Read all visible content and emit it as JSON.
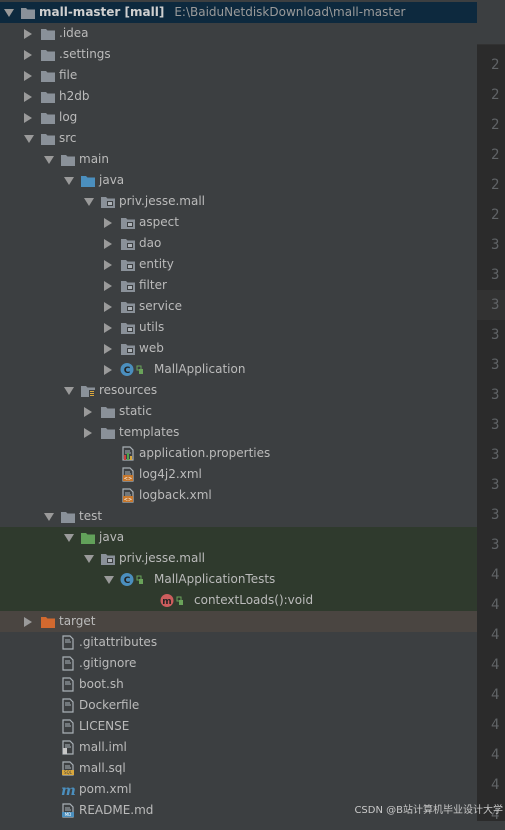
{
  "project": {
    "name": "mall-master",
    "module": "[mall]",
    "path": "E:\\BaiduNetdiskDownload\\mall-master"
  },
  "tree": {
    "idea": ".idea",
    "settings": ".settings",
    "file": "file",
    "h2db": "h2db",
    "log": "log",
    "src": "src",
    "main": "main",
    "main_java": "java",
    "main_pkg": "priv.jesse.mall",
    "aspect": "aspect",
    "dao": "dao",
    "entity": "entity",
    "filter": "filter",
    "service": "service",
    "utils": "utils",
    "web": "web",
    "mall_application": "MallApplication",
    "resources": "resources",
    "static": "static",
    "templates": "templates",
    "application_properties": "application.properties",
    "log4j2": "log4j2.xml",
    "logback": "logback.xml",
    "test": "test",
    "test_java": "java",
    "test_pkg": "priv.jesse.mall",
    "mall_application_tests": "MallApplicationTests",
    "context_loads": "contextLoads():void",
    "target": "target",
    "gitattributes": ".gitattributes",
    "gitignore": ".gitignore",
    "boot_sh": "boot.sh",
    "dockerfile": "Dockerfile",
    "license": "LICENSE",
    "mall_iml": "mall.iml",
    "mall_sql": "mall.sql",
    "pom_xml": "pom.xml",
    "readme": "README.md"
  },
  "gutter": {
    "line_numbers": [
      "2",
      "2",
      "2",
      "2",
      "2",
      "2",
      "3",
      "3",
      "3",
      "3",
      "3",
      "3",
      "3",
      "3",
      "3",
      "3",
      "3",
      "4",
      "4",
      "4",
      "4",
      "4",
      "4",
      "4",
      "4",
      "4"
    ]
  },
  "watermark": "CSDN @B站计算机毕业设计大学",
  "colors": {
    "background": "#3c3f41",
    "selection": "#0d293e",
    "test_root": "#2f3a2d",
    "excluded": "#4a4541",
    "folder": "#8a9199",
    "source_folder": "#4b8fbe",
    "test_folder": "#62a15a",
    "excluded_folder": "#d2692f"
  }
}
